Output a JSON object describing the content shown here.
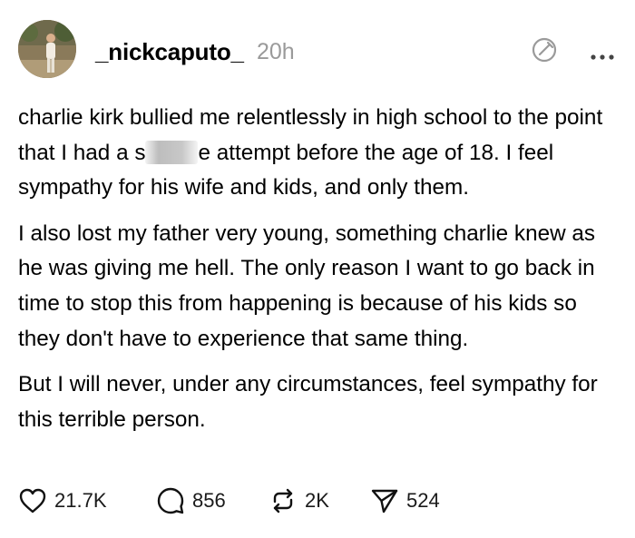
{
  "post": {
    "username": "_nickcaputo_",
    "time": "20h",
    "avatar_icon": "profile-photo",
    "paragraphs": {
      "p1_a": "charlie kirk bullied me relentlessly in high school to the point that I had a s",
      "p1_b": "e attempt before the age of 18. I feel sympathy for his wife and kids, and only them.",
      "p2": "I also lost my father very young, something charlie knew as he was giving me hell. The only reason I want to go back in time to stop this from happening is because of his kids so they don't have to experience that same thing.",
      "p3": "But I will never, under any circumstances, feel sympathy for this terrible person."
    }
  },
  "actions": {
    "likes": "21.7K",
    "comments": "856",
    "reposts": "2K",
    "shares": "524"
  },
  "icons": {
    "edit": "edit-circle-icon",
    "more": "more-dots-icon",
    "like": "heart-icon",
    "comment": "comment-bubble-icon",
    "repost": "repost-icon",
    "share": "send-icon"
  }
}
